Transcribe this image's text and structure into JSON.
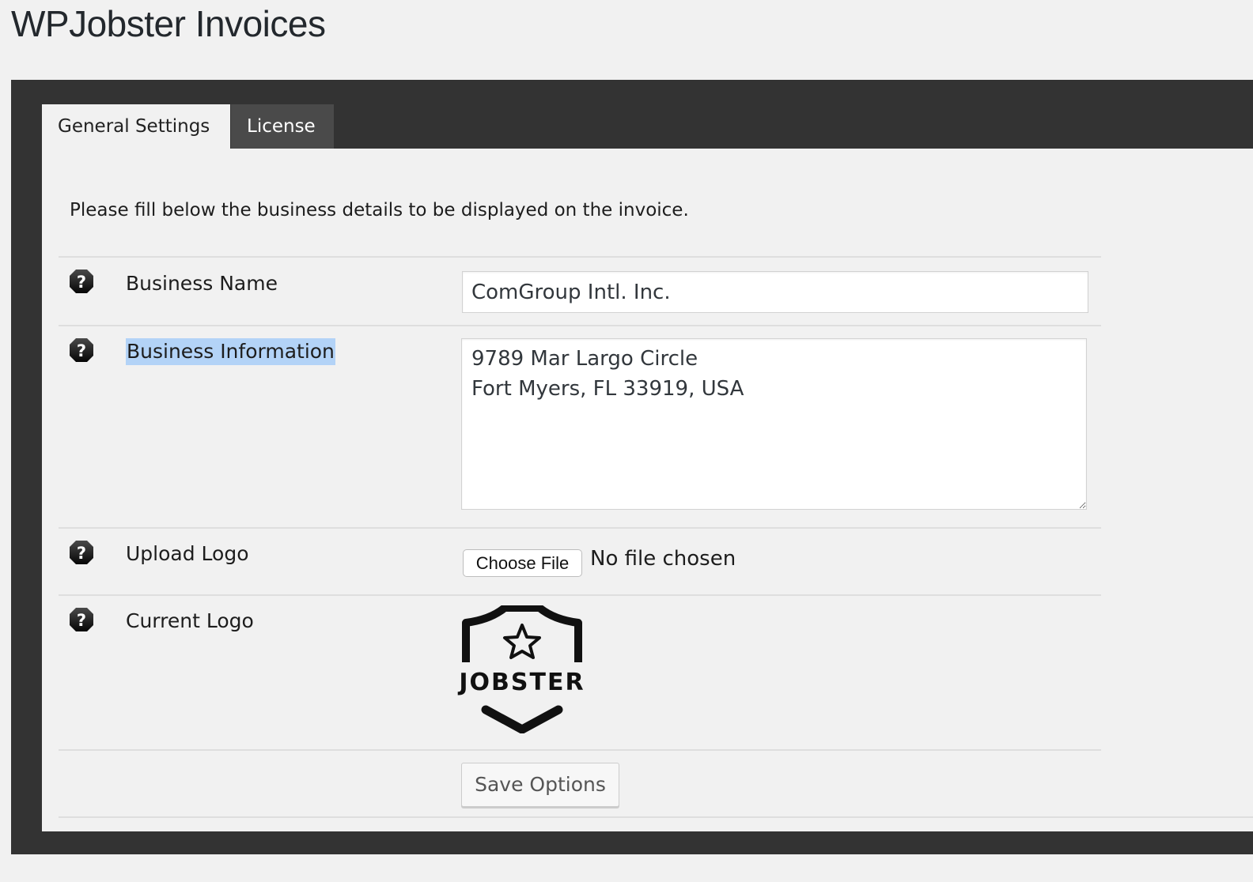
{
  "page": {
    "title": "WPJobster Invoices"
  },
  "tabs": [
    {
      "label": "General Settings",
      "active": true
    },
    {
      "label": "License",
      "active": false
    }
  ],
  "form": {
    "intro": "Please fill below the business details to be displayed on the invoice.",
    "business_name": {
      "label": "Business Name",
      "value": "ComGroup Intl. Inc."
    },
    "business_information": {
      "label": "Business Information",
      "value": "9789 Mar Largo Circle\nFort Myers, FL 33919, USA"
    },
    "upload_logo": {
      "label": "Upload Logo",
      "button_label": "Choose File",
      "status": "No file chosen"
    },
    "current_logo": {
      "label": "Current Logo",
      "logo_text": "JOBSTER"
    },
    "save_label": "Save Options"
  },
  "icons": {
    "help": "help-icon",
    "logo_star": "star-icon"
  },
  "colors": {
    "frame": "#333333",
    "panel": "#f1f1f1",
    "inactive_tab": "#4a4a4a",
    "highlight": "#b3d3f7"
  }
}
